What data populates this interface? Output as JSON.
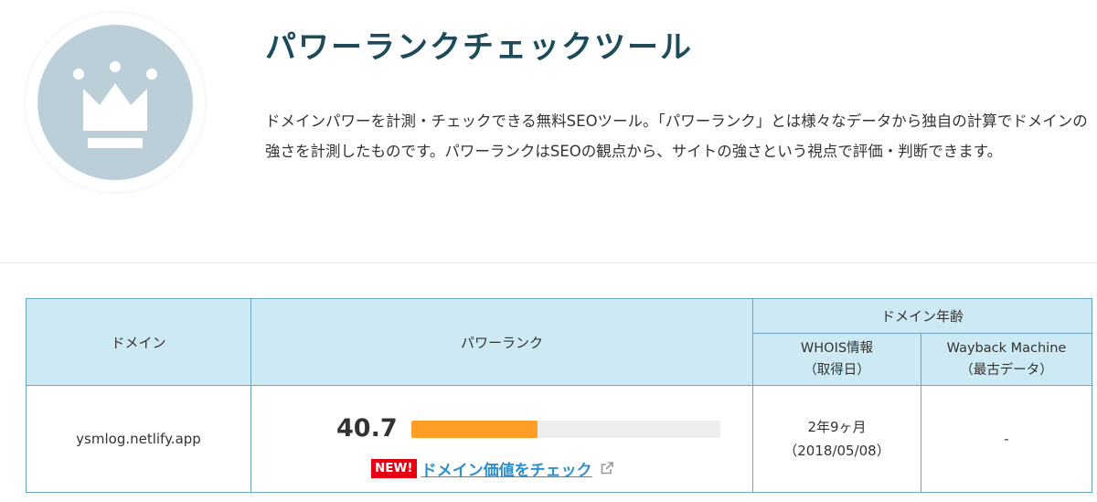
{
  "header": {
    "title": "パワーランクチェックツール",
    "description": "ドメインパワーを計測・チェックできる無料SEOツール。「パワーランク」とは様々なデータから独自の計算でドメインの強さを計測したものです。パワーランクはSEOの観点から、サイトの強さという視点で評価・判断できます。",
    "logo_icon": "crown-icon"
  },
  "table": {
    "headers": {
      "domain": "ドメイン",
      "power_rank": "パワーランク",
      "domain_age": "ドメイン年齢",
      "whois_line1": "WHOIS情報",
      "whois_line2": "（取得日）",
      "wayback_line1": "Wayback Machine",
      "wayback_line2": "（最古データ）"
    },
    "row": {
      "domain": "ysmlog.netlify.app",
      "score": "40.7",
      "score_fraction": 0.407,
      "new_badge": "NEW!",
      "check_link": "ドメイン価値をチェック",
      "whois_age": "2年9ヶ月",
      "whois_date": "（2018/05/08）",
      "wayback": "-"
    }
  },
  "colors": {
    "title": "#1d4b5a",
    "header_bg": "#cde9f4",
    "border": "#6aa6bd",
    "bar_fill": "#ff9e26",
    "badge": "#e60012",
    "link": "#2b8fd0",
    "logo_bg": "#bccfd9"
  }
}
